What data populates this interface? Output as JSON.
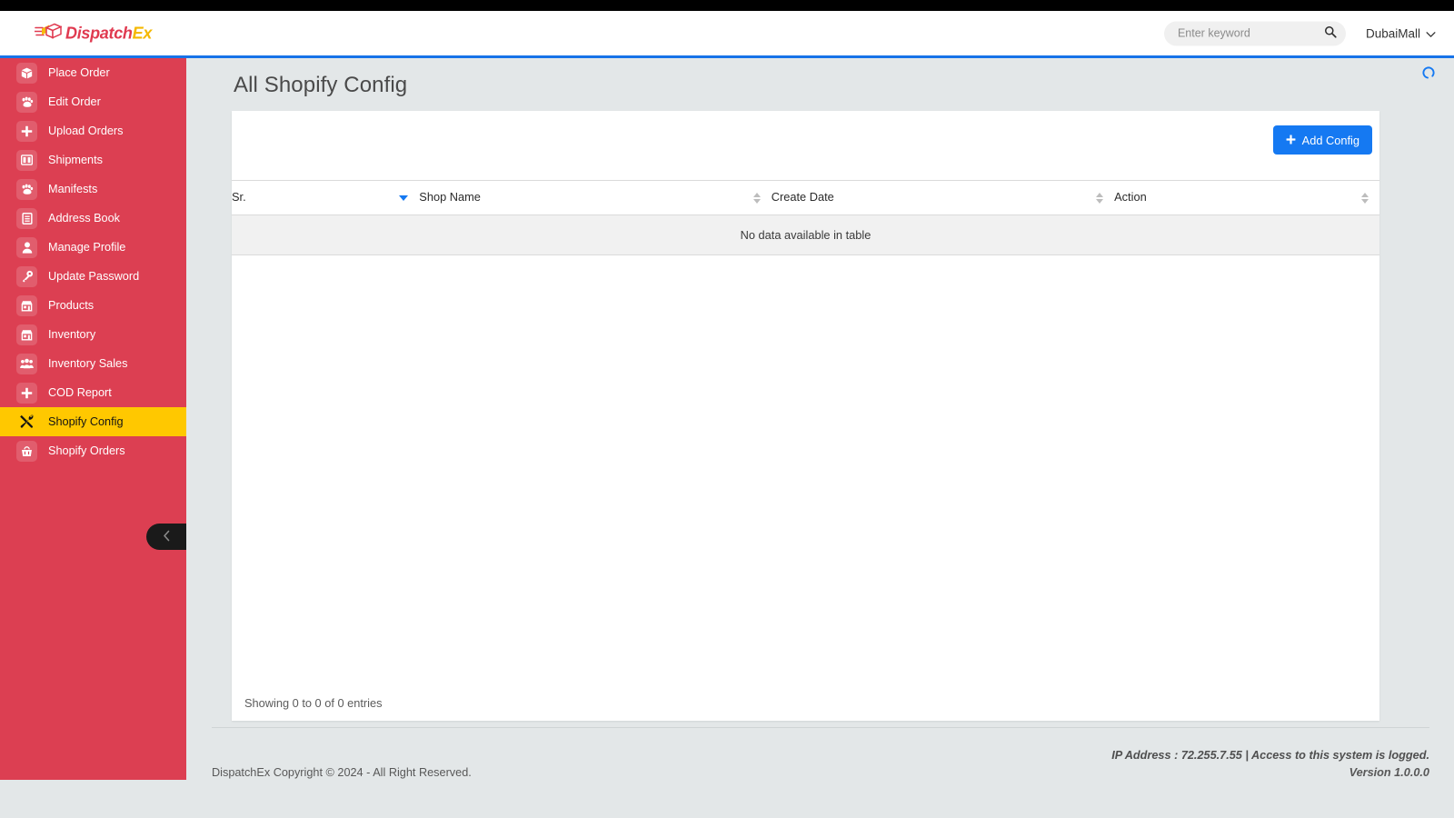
{
  "colors": {
    "sidebar_bg": "#dc3f52",
    "sidebar_active_bg": "#ffc800",
    "accent_blue": "#1579f2",
    "logo_red": "#e03a50",
    "logo_yellow": "#f5b800",
    "content_bg": "#e3e7e8",
    "topbar_black": "#000000"
  },
  "header": {
    "logo_primary": "Dispatch",
    "logo_accent": "Ex",
    "logo_icon": "package-box-icon",
    "search": {
      "placeholder": "Enter keyword",
      "value": "",
      "icon": "search-icon"
    },
    "user": {
      "name": "DubaiMall",
      "caret_icon": "chevron-down-icon"
    },
    "loading_spinner": "loading-spinner-icon"
  },
  "sidebar": {
    "collapse_button_icon": "chevron-left-icon",
    "items": [
      {
        "label": "Place Order",
        "icon": "box-icon",
        "active": false
      },
      {
        "label": "Edit Order",
        "icon": "paw-icon",
        "active": false
      },
      {
        "label": "Upload Orders",
        "icon": "plus-icon",
        "active": false
      },
      {
        "label": "Shipments",
        "icon": "columns-icon",
        "active": false
      },
      {
        "label": "Manifests",
        "icon": "paw-icon",
        "active": false
      },
      {
        "label": "Address Book",
        "icon": "book-icon",
        "active": false
      },
      {
        "label": "Manage Profile",
        "icon": "user-icon",
        "active": false
      },
      {
        "label": "Update Password",
        "icon": "key-icon",
        "active": false
      },
      {
        "label": "Products",
        "icon": "store-icon",
        "active": false
      },
      {
        "label": "Inventory",
        "icon": "store-icon",
        "active": false
      },
      {
        "label": "Inventory Sales",
        "icon": "users-icon",
        "active": false
      },
      {
        "label": "COD Report",
        "icon": "plus-icon",
        "active": false
      },
      {
        "label": "Shopify Config",
        "icon": "tools-icon",
        "active": true
      },
      {
        "label": "Shopify Orders",
        "icon": "basket-icon",
        "active": false
      }
    ]
  },
  "main": {
    "title": "All Shopify Config",
    "add_button": {
      "label": "Add Config",
      "icon": "plus-icon"
    },
    "table": {
      "columns": [
        {
          "label": "Sr.",
          "sort": "desc"
        },
        {
          "label": "Shop Name",
          "sort": "none"
        },
        {
          "label": "Create Date",
          "sort": "none"
        },
        {
          "label": "Action",
          "sort": "none"
        }
      ],
      "rows": [],
      "empty_message": "No data available in table",
      "entries_info": "Showing 0 to 0 of 0 entries"
    }
  },
  "footer": {
    "copyright": "DispatchEx Copyright © 2024 - All Right Reserved.",
    "ip_notice": "IP Address : 72.255.7.55 | Access to this system is logged.",
    "version": "Version 1.0.0.0"
  }
}
